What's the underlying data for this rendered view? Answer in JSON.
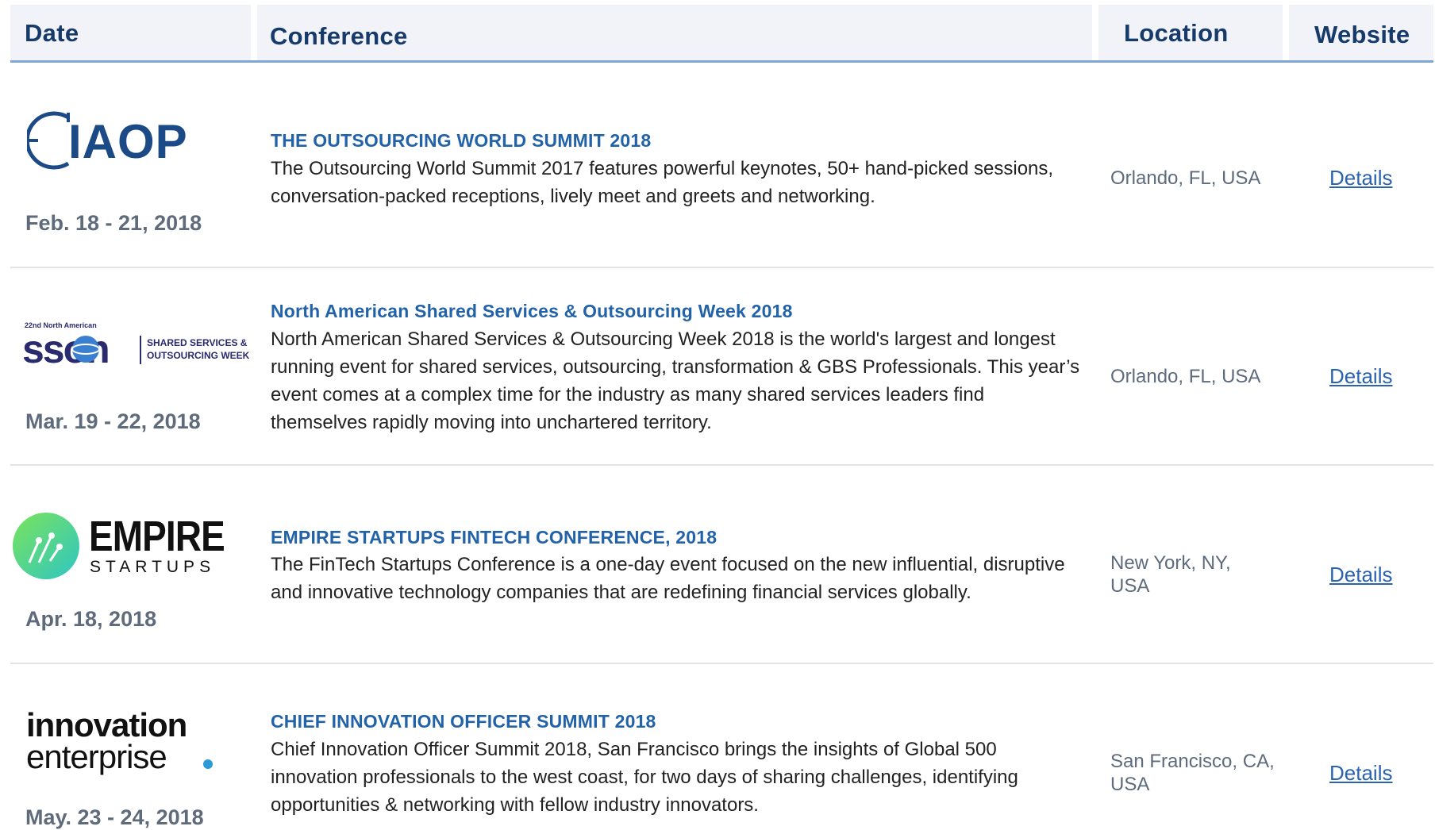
{
  "header": {
    "date_label": "Date",
    "conference_label": "Conference",
    "location_label": "Location",
    "website_label": "Website"
  },
  "colors": {
    "header_bg": "#f1f3f8",
    "header_text": "#163a6a",
    "title_blue": "#2262a9",
    "link_blue": "#2a63b0"
  },
  "rows": [
    {
      "logo": {
        "text": "IAOP",
        "icon": "iaop-logo"
      },
      "date": "Feb. 18 - 21, 2018",
      "title": "THE OUTSOURCING WORLD SUMMIT 2018",
      "desc_lines": [
        "The Outsourcing World Summit 2017 features powerful keynotes, 50+ hand-picked sessions,",
        "conversation-packed receptions, lively meet and greets and networking."
      ],
      "location_lines": [
        "Orlando,  FL, USA"
      ],
      "link": "Details"
    },
    {
      "logo": {
        "small_text": "22nd North American",
        "main_text": "sson",
        "side_line1": "SHARED SERVICES &",
        "side_line2": "OUTSOURCING WEEK",
        "icon": "sson-logo"
      },
      "date": "Mar. 19 - 22, 2018",
      "title": "North American Shared Services & Outsourcing Week 2018",
      "desc_lines": [
        "North American Shared Services & Outsourcing Week 2018 is the world's largest and longest",
        "running event for shared services, outsourcing, transformation & GBS Professionals. This year’s",
        "event comes at a complex time for the industry as many shared services leaders find",
        "themselves rapidly moving into unchartered territory."
      ],
      "location_lines": [
        "Orlando, FL, USA"
      ],
      "link": "Details"
    },
    {
      "logo": {
        "main_text": "EMPIRE",
        "sub_text": "STARTUPS",
        "icon": "empire-startups-logo"
      },
      "date": "Apr. 18, 2018",
      "title": "EMPIRE STARTUPS FINTECH CONFERENCE, 2018",
      "desc_lines": [
        "The FinTech Startups Conference is a one-day event focused on the new influential, disruptive",
        "and innovative technology companies that are redefining financial services globally."
      ],
      "location_lines": [
        "New York, NY,",
        "USA"
      ],
      "link": "Details"
    },
    {
      "logo": {
        "line1": "innovation",
        "line2": "enterprise",
        "icon": "innovation-enterprise-logo"
      },
      "date": "May. 23 - 24, 2018",
      "title": "CHIEF INNOVATION OFFICER SUMMIT 2018",
      "desc_lines": [
        "Chief Innovation Officer Summit 2018, San Francisco brings the insights of Global 500",
        "innovation professionals to the west coast, for two days of sharing challenges, identifying",
        "opportunities & networking with fellow industry innovators."
      ],
      "location_lines": [
        "San Francisco, CA,",
        "USA"
      ],
      "link": "Details"
    }
  ]
}
